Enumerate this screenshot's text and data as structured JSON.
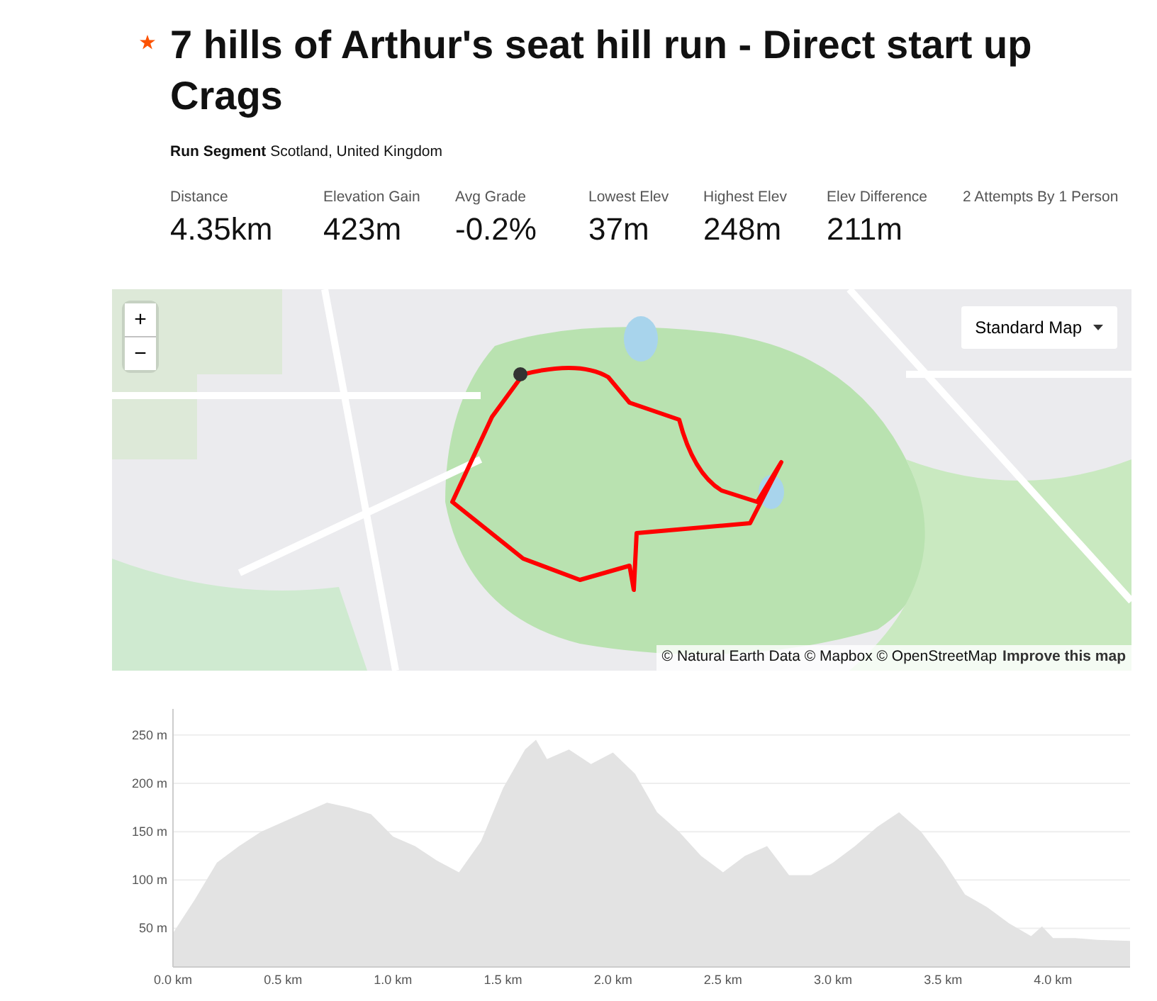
{
  "segment": {
    "title": "7 hills of Arthur's seat hill run - Direct start up Crags",
    "starred": true,
    "type": "Run Segment",
    "location": "Scotland, United Kingdom"
  },
  "stats": [
    {
      "label": "Distance",
      "value": "4.35km"
    },
    {
      "label": "Elevation Gain",
      "value": "423m"
    },
    {
      "label": "Avg Grade",
      "value": "-0.2%"
    },
    {
      "label": "Lowest Elev",
      "value": "37m"
    },
    {
      "label": "Highest Elev",
      "value": "248m"
    },
    {
      "label": "Elev Difference",
      "value": "211m"
    },
    {
      "label": "2 Attempts By 1 Person"
    }
  ],
  "map": {
    "kind": "picture",
    "zoom_in": "+",
    "zoom_out": "−",
    "style_menu": "Standard Map",
    "attribution": "© Natural Earth Data © Mapbox © OpenStreetMap",
    "improve_link": "Improve this map"
  },
  "elevation": {
    "chart_data": {
      "type": "area",
      "grid": true,
      "xlim": [
        0,
        4.35
      ],
      "ylim": [
        10,
        277
      ],
      "xticks": [
        {
          "value": 0,
          "label": "0.0 km"
        },
        {
          "value": 0.5,
          "label": "0.5 km"
        },
        {
          "value": 1,
          "label": "1.0 km"
        },
        {
          "value": 1.5,
          "label": "1.5 km"
        },
        {
          "value": 2,
          "label": "2.0 km"
        },
        {
          "value": 2.5,
          "label": "2.5 km"
        },
        {
          "value": 3,
          "label": "3.0 km"
        },
        {
          "value": 3.5,
          "label": "3.5 km"
        },
        {
          "value": 4,
          "label": "4.0 km"
        }
      ],
      "yticks": [
        {
          "value": 50,
          "label": "50 m"
        },
        {
          "value": 100,
          "label": "100 m"
        },
        {
          "value": 150,
          "label": "150 m"
        },
        {
          "value": 200,
          "label": "200 m"
        },
        {
          "value": 250,
          "label": "250 m"
        }
      ],
      "x": [
        0,
        0.1,
        0.2,
        0.3,
        0.4,
        0.5,
        0.6,
        0.7,
        0.8,
        0.9,
        1.0,
        1.1,
        1.2,
        1.3,
        1.4,
        1.5,
        1.6,
        1.65,
        1.7,
        1.8,
        1.9,
        2.0,
        2.1,
        2.2,
        2.3,
        2.4,
        2.5,
        2.6,
        2.7,
        2.8,
        2.9,
        3.0,
        3.1,
        3.2,
        3.3,
        3.4,
        3.5,
        3.6,
        3.7,
        3.8,
        3.9,
        3.95,
        4.0,
        4.1,
        4.2,
        4.35
      ],
      "series": [
        {
          "color": "#e3e3e3",
          "values": [
            45,
            80,
            118,
            135,
            150,
            160,
            170,
            180,
            175,
            168,
            145,
            135,
            120,
            108,
            140,
            195,
            235,
            245,
            225,
            235,
            220,
            232,
            210,
            170,
            150,
            125,
            108,
            125,
            135,
            105,
            105,
            118,
            135,
            155,
            170,
            150,
            120,
            85,
            72,
            55,
            42,
            52,
            40,
            40,
            38,
            37
          ]
        }
      ]
    }
  }
}
